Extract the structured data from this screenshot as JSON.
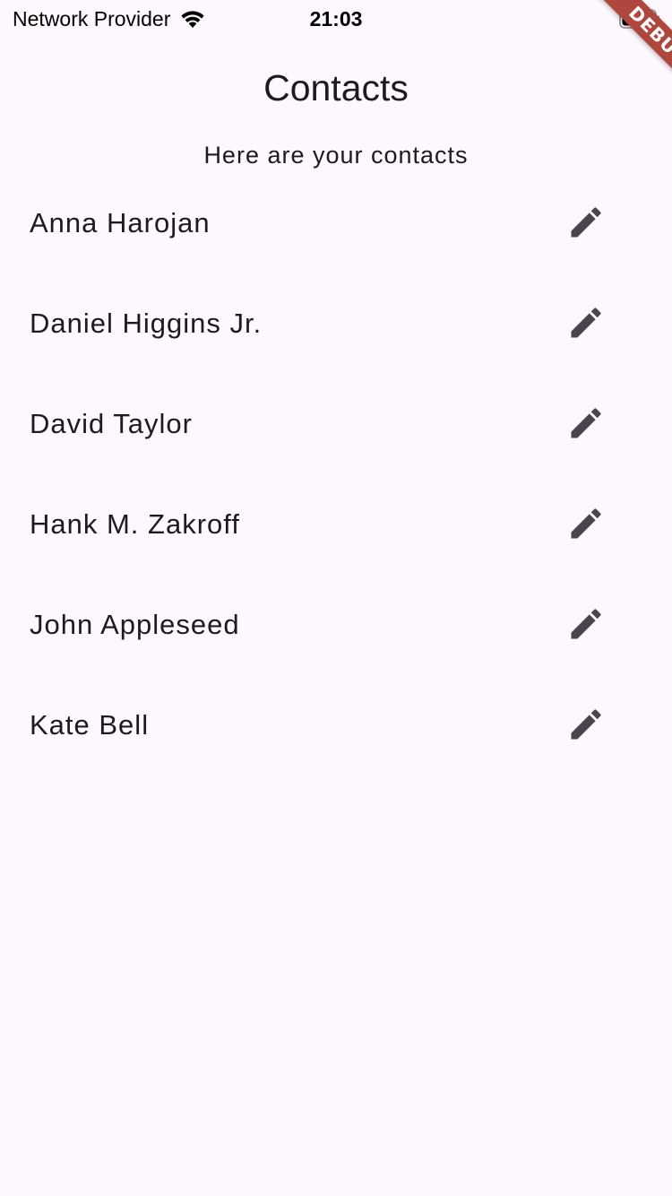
{
  "status_bar": {
    "carrier": "Network Provider",
    "time": "21:03",
    "wifi_icon": "wifi-icon",
    "battery_icon": "battery-icon"
  },
  "debug_banner": {
    "label": "DEBUG",
    "color": "#b0473e"
  },
  "app_bar": {
    "title": "Contacts"
  },
  "subtitle": "Here are your contacts",
  "contacts": [
    {
      "name": "Anna Harojan",
      "action_icon": "edit-icon"
    },
    {
      "name": "Daniel Higgins Jr.",
      "action_icon": "edit-icon"
    },
    {
      "name": "David Taylor",
      "action_icon": "edit-icon"
    },
    {
      "name": "Hank M. Zakroff",
      "action_icon": "edit-icon"
    },
    {
      "name": "John Appleseed",
      "action_icon": "edit-icon"
    },
    {
      "name": "Kate Bell",
      "action_icon": "edit-icon"
    }
  ],
  "colors": {
    "background": "#fdf7fe",
    "text": "#1d1b20",
    "icon": "#49454f"
  }
}
